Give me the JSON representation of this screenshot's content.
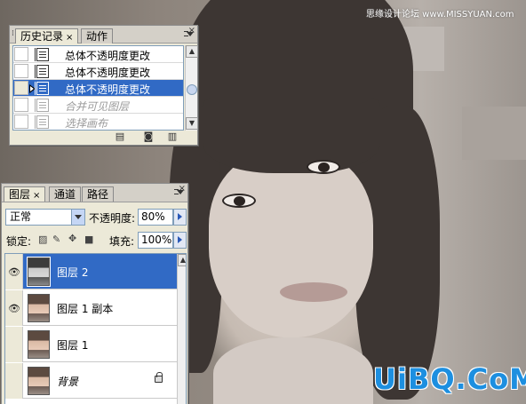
{
  "watermark_top": "思缘设计论坛 www.MISSYUAN.com",
  "watermark_logo": "UiBQ.CoM",
  "history_panel": {
    "tabs": [
      {
        "label": "历史记录",
        "close": "×"
      },
      {
        "label": "动作"
      }
    ],
    "items": [
      {
        "label": "总体不透明度更改",
        "state": "normal"
      },
      {
        "label": "总体不透明度更改",
        "state": "normal"
      },
      {
        "label": "总体不透明度更改",
        "state": "selected"
      },
      {
        "label": "合并可见图层",
        "state": "dimmed"
      },
      {
        "label": "选择画布",
        "state": "dimmed"
      }
    ],
    "footer_icons": [
      "new-document-from-state-icon",
      "new-snapshot-icon",
      "delete-icon"
    ]
  },
  "layers_panel": {
    "tabs": [
      {
        "label": "图层",
        "close": "×"
      },
      {
        "label": "通道"
      },
      {
        "label": "路径"
      }
    ],
    "blend_mode": "正常",
    "opacity_label": "不透明度:",
    "opacity_value": "80%",
    "lock_label": "锁定:",
    "lock_icons": [
      "lock-transparency-icon",
      "lock-image-icon",
      "lock-position-icon",
      "lock-all-icon"
    ],
    "fill_label": "填充:",
    "fill_value": "100%",
    "layers": [
      {
        "name": "图层 2",
        "visible": true,
        "selected": true,
        "thumb": "gray"
      },
      {
        "name": "图层 1 副本",
        "visible": true,
        "selected": false,
        "thumb": "color"
      },
      {
        "name": "图层 1",
        "visible": false,
        "selected": false,
        "thumb": "color"
      },
      {
        "name": "背景",
        "visible": false,
        "selected": false,
        "thumb": "color",
        "locked": true
      }
    ]
  }
}
